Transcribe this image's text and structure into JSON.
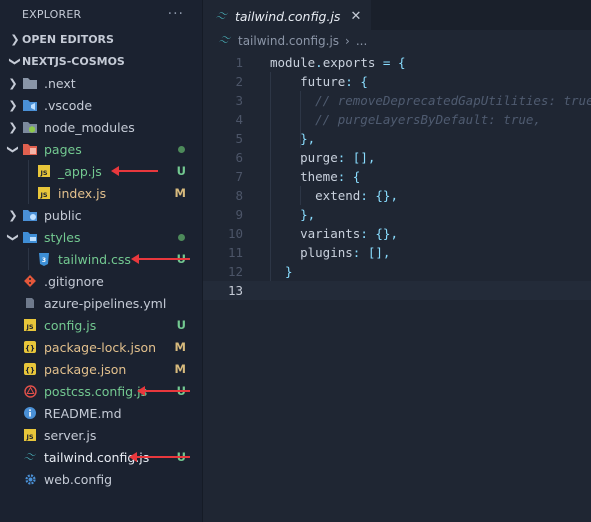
{
  "sidebar": {
    "header_title": "EXPLORER",
    "header_more": "···",
    "sections": [
      {
        "label": "OPEN EDITORS",
        "expanded": false
      },
      {
        "label": "NEXTJS-COSMOS",
        "expanded": true
      }
    ],
    "tree": [
      {
        "label": ".next",
        "icon": "folder-icon",
        "depth": 1,
        "chevron": "closed",
        "status": "",
        "label_style": "normal"
      },
      {
        "label": ".vscode",
        "icon": "vscode-folder-icon",
        "depth": 1,
        "chevron": "closed",
        "status": "",
        "label_style": "normal"
      },
      {
        "label": "node_modules",
        "icon": "node-folder-icon",
        "depth": 1,
        "chevron": "closed",
        "status": "",
        "label_style": "normal"
      },
      {
        "label": "pages",
        "icon": "pages-folder-icon",
        "depth": 1,
        "chevron": "open",
        "status": "dot",
        "label_style": "u"
      },
      {
        "label": "_app.js",
        "icon": "js-file-icon",
        "depth": 2,
        "chevron": "none",
        "status": "U",
        "label_style": "u"
      },
      {
        "label": "index.js",
        "icon": "js-file-icon",
        "depth": 2,
        "chevron": "none",
        "status": "M",
        "label_style": "m"
      },
      {
        "label": "public",
        "icon": "public-folder-icon",
        "depth": 1,
        "chevron": "closed",
        "status": "",
        "label_style": "normal"
      },
      {
        "label": "styles",
        "icon": "styles-folder-icon",
        "depth": 1,
        "chevron": "open",
        "status": "dot",
        "label_style": "u"
      },
      {
        "label": "tailwind.css",
        "icon": "css-file-icon",
        "depth": 2,
        "chevron": "none",
        "status": "U",
        "label_style": "u"
      },
      {
        "label": ".gitignore",
        "icon": "git-icon",
        "depth": 1,
        "chevron": "none",
        "status": "",
        "label_style": "normal"
      },
      {
        "label": "azure-pipelines.yml",
        "icon": "yaml-file-icon",
        "depth": 1,
        "chevron": "none",
        "status": "",
        "label_style": "normal"
      },
      {
        "label": "config.js",
        "icon": "js-file-icon",
        "depth": 1,
        "chevron": "none",
        "status": "U",
        "label_style": "u"
      },
      {
        "label": "package-lock.json",
        "icon": "json-file-icon",
        "depth": 1,
        "chevron": "none",
        "status": "M",
        "label_style": "m"
      },
      {
        "label": "package.json",
        "icon": "json-file-icon",
        "depth": 1,
        "chevron": "none",
        "status": "M",
        "label_style": "m"
      },
      {
        "label": "postcss.config.js",
        "icon": "postcss-file-icon",
        "depth": 1,
        "chevron": "none",
        "status": "U",
        "label_style": "u"
      },
      {
        "label": "README.md",
        "icon": "info-icon",
        "depth": 1,
        "chevron": "none",
        "status": "",
        "label_style": "normal"
      },
      {
        "label": "server.js",
        "icon": "js-file-icon",
        "depth": 1,
        "chevron": "none",
        "status": "",
        "label_style": "normal"
      },
      {
        "label": "tailwind.config.js",
        "icon": "tailwind-icon",
        "depth": 1,
        "chevron": "none",
        "status": "U",
        "label_style": "active"
      },
      {
        "label": "web.config",
        "icon": "gear-icon",
        "depth": 1,
        "chevron": "none",
        "status": "",
        "label_style": "normal"
      }
    ]
  },
  "editor": {
    "tab": {
      "label": "tailwind.config.js",
      "close": "✕"
    },
    "breadcrumb": {
      "file": "tailwind.config.js",
      "sep": "›",
      "more": "..."
    },
    "current_line": 13,
    "lines": [
      [
        {
          "t": "module",
          "c": "k"
        },
        {
          "t": ".",
          "c": "op"
        },
        {
          "t": "exports",
          "c": "k"
        },
        {
          "t": " = ",
          "c": "op"
        },
        {
          "t": "{",
          "c": "br"
        }
      ],
      [
        {
          "t": "    future",
          "c": "p"
        },
        {
          "t": ": ",
          "c": "op"
        },
        {
          "t": "{",
          "c": "br"
        }
      ],
      [
        {
          "t": "      // removeDeprecatedGapUtilities: true,",
          "c": "com"
        }
      ],
      [
        {
          "t": "      // purgeLayersByDefault: true,",
          "c": "com"
        }
      ],
      [
        {
          "t": "    }",
          "c": "br"
        },
        {
          "t": ",",
          "c": "op"
        }
      ],
      [
        {
          "t": "    purge",
          "c": "p"
        },
        {
          "t": ": ",
          "c": "op"
        },
        {
          "t": "[]",
          "c": "br"
        },
        {
          "t": ",",
          "c": "op"
        }
      ],
      [
        {
          "t": "    theme",
          "c": "p"
        },
        {
          "t": ": ",
          "c": "op"
        },
        {
          "t": "{",
          "c": "br"
        }
      ],
      [
        {
          "t": "      extend",
          "c": "p"
        },
        {
          "t": ": ",
          "c": "op"
        },
        {
          "t": "{}",
          "c": "br"
        },
        {
          "t": ",",
          "c": "op"
        }
      ],
      [
        {
          "t": "    }",
          "c": "br"
        },
        {
          "t": ",",
          "c": "op"
        }
      ],
      [
        {
          "t": "    variants",
          "c": "p"
        },
        {
          "t": ": ",
          "c": "op"
        },
        {
          "t": "{}",
          "c": "br"
        },
        {
          "t": ",",
          "c": "op"
        }
      ],
      [
        {
          "t": "    plugins",
          "c": "p"
        },
        {
          "t": ": ",
          "c": "op"
        },
        {
          "t": "[]",
          "c": "br"
        },
        {
          "t": ",",
          "c": "op"
        }
      ],
      [
        {
          "t": "  }",
          "c": "br"
        }
      ],
      []
    ]
  },
  "annotations": {
    "arrow_color": "#e8383d"
  },
  "colors": {
    "untracked": "#73c991",
    "modified": "#e2c08d",
    "sidebar_bg": "#1b2230",
    "editor_bg": "#1f2633"
  }
}
